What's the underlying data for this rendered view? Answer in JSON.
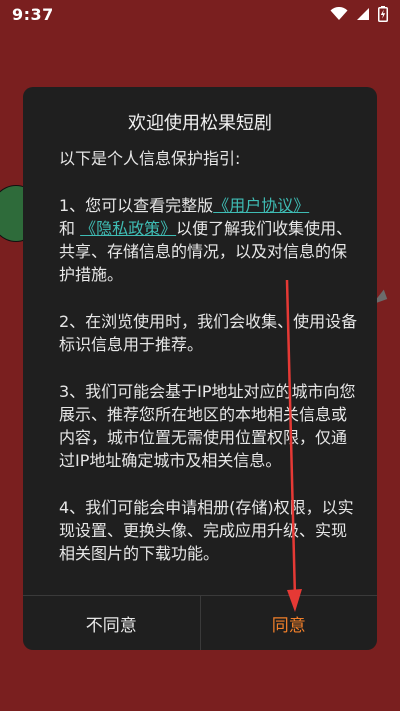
{
  "status_bar": {
    "time": "9:37",
    "icons": [
      "wifi-icon",
      "signal-icon",
      "battery-charging-icon"
    ]
  },
  "dialog": {
    "title": "欢迎使用松果短剧",
    "intro": "以下是个人信息保护指引:",
    "p1_prefix": "1、您可以查看完整版",
    "p1_link1": "《用户协议》",
    "p1_mid": "和",
    "p1_link2": "《隐私政策》",
    "p1_suffix": "以便了解我们收集使用、共享、存储信息的情况，以及对信息的保护措施。",
    "p2": "2、在浏览使用时，我们会收集、使用设备标识信息用于推荐。",
    "p3": "3、我们可能会基于IP地址对应的城市向您展示、推荐您所在地区的本地相关信息或内容，城市位置无需使用位置权限，仅通过IP地址确定城市及相关信息。",
    "p4": "4、我们可能会申请相册(存储)权限，以实现设置、更换头像、完成应用升级、实现相关图片的下载功能。",
    "disagree_label": "不同意",
    "agree_label": "同意"
  },
  "colors": {
    "background": "#7a1f1f",
    "dialog": "#1f1f1f",
    "link": "#3fbcb4",
    "agree": "#f07f2a",
    "annotation_arrow": "#e53935"
  }
}
